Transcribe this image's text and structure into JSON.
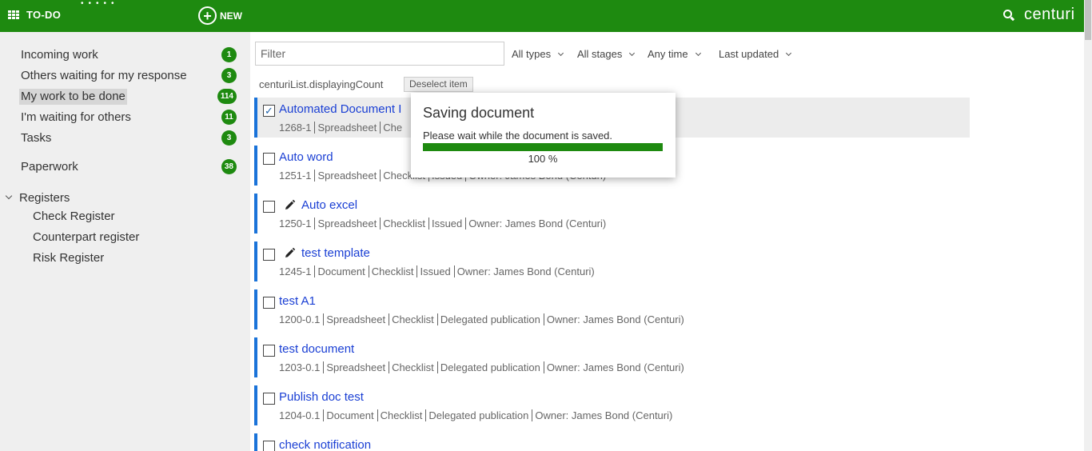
{
  "topbar": {
    "todo_label": "TO-DO",
    "new_label": "NEW",
    "brand": "centuri",
    "color": "#1e8a10"
  },
  "sidebar": {
    "items": [
      {
        "label": "Incoming work",
        "count": "1"
      },
      {
        "label": "Others waiting for my response",
        "count": "3"
      },
      {
        "label": "My work to be done",
        "count": "114",
        "selected": true
      },
      {
        "label": "I'm waiting for others",
        "count": "11"
      },
      {
        "label": "Tasks",
        "count": "3"
      },
      {
        "label": "Paperwork",
        "count": "38"
      }
    ],
    "registers": {
      "label": "Registers",
      "items": [
        "Check Register",
        "Counterpart register",
        "Risk Register"
      ]
    }
  },
  "filters": {
    "placeholder": "Filter",
    "types": "All types",
    "stages": "All stages",
    "time": "Any time",
    "sort": "Last updated"
  },
  "list": {
    "count_label": "centuriList.displayingCount",
    "deselect_label": "Deselect item",
    "rows": [
      {
        "title": "Automated Document I",
        "meta": [
          "1268-1",
          "Spreadsheet",
          "Che"
        ],
        "checked": true,
        "pencil": false,
        "selected": true
      },
      {
        "title": "Auto word",
        "meta": [
          "1251-1",
          "Spreadsheet",
          "Checklist",
          "Issued",
          "Owner: James Bond (Centuri)"
        ],
        "checked": false,
        "pencil": false
      },
      {
        "title": "Auto excel",
        "meta": [
          "1250-1",
          "Spreadsheet",
          "Checklist",
          "Issued",
          "Owner: James Bond (Centuri)"
        ],
        "checked": false,
        "pencil": true
      },
      {
        "title": "test template",
        "meta": [
          "1245-1",
          "Document",
          "Checklist",
          "Issued",
          "Owner: James Bond (Centuri)"
        ],
        "checked": false,
        "pencil": true
      },
      {
        "title": "test A1",
        "meta": [
          "1200-0.1",
          "Spreadsheet",
          "Checklist",
          "Delegated publication",
          "Owner: James Bond (Centuri)"
        ],
        "checked": false,
        "pencil": false
      },
      {
        "title": "test document",
        "meta": [
          "1203-0.1",
          "Spreadsheet",
          "Checklist",
          "Delegated publication",
          "Owner: James Bond (Centuri)"
        ],
        "checked": false,
        "pencil": false
      },
      {
        "title": "Publish doc test",
        "meta": [
          "1204-0.1",
          "Document",
          "Checklist",
          "Delegated publication",
          "Owner: James Bond (Centuri)"
        ],
        "checked": false,
        "pencil": false
      },
      {
        "title": "check notification",
        "meta": [],
        "checked": false,
        "pencil": false
      }
    ]
  },
  "dialog": {
    "title": "Saving document",
    "message": "Please wait while the document is saved.",
    "progress": 1.0,
    "progress_text": "100 %"
  }
}
